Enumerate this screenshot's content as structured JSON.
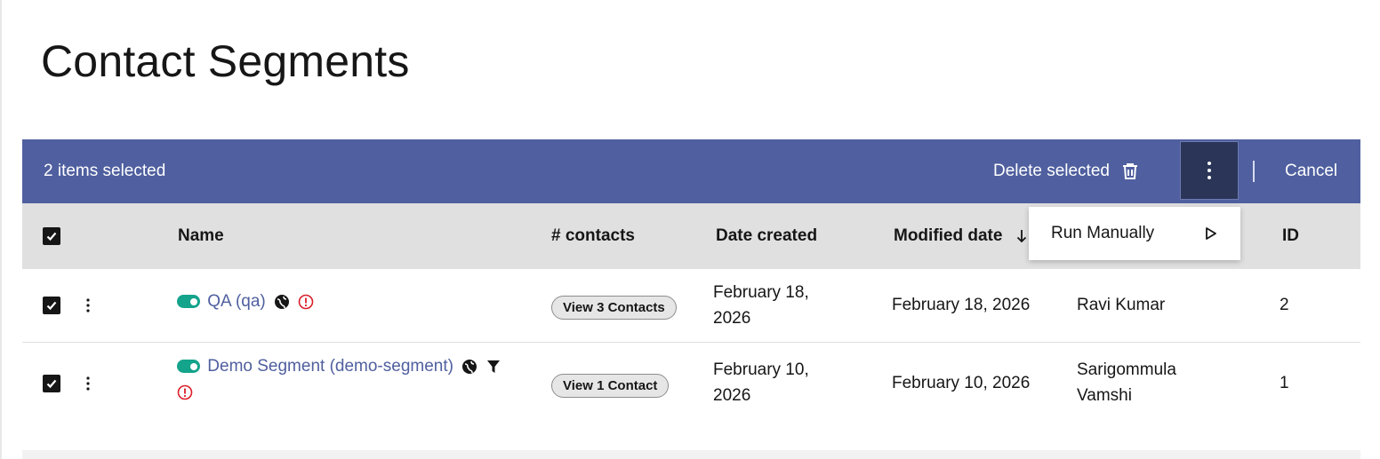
{
  "page": {
    "title": "Contact Segments"
  },
  "bulk_bar": {
    "selected_text": "2 items selected",
    "delete_label": "Delete selected",
    "cancel_label": "Cancel"
  },
  "menu": {
    "run_manually": "Run Manually"
  },
  "table": {
    "columns": {
      "name": "Name",
      "contacts": "# contacts",
      "date_created": "Date created",
      "modified_date": "Modified date",
      "id": "ID"
    },
    "rows": [
      {
        "name": "QA (qa)",
        "contacts_button": "View 3 Contacts",
        "date_created_line1": "February 18,",
        "date_created_line2": "2026",
        "modified_date": "February 18, 2026",
        "created_by_line1": "Ravi Kumar",
        "created_by_line2": "",
        "id": "2",
        "icons": [
          "toggle-on-icon",
          "globe-icon",
          "warning-icon"
        ]
      },
      {
        "name": "Demo Segment (demo-segment)",
        "contacts_button": "View 1 Contact",
        "date_created_line1": "February 10,",
        "date_created_line2": "2026",
        "modified_date": "February 10, 2026",
        "created_by_line1": "Sarigommula",
        "created_by_line2": "Vamshi",
        "id": "1",
        "icons": [
          "toggle-on-icon",
          "globe-icon",
          "filter-icon",
          "warning-icon"
        ]
      }
    ]
  },
  "colors": {
    "bulk_bar": "#4f5f9f",
    "kebab_active": "#2b3558",
    "header_bg": "#e0e0e0",
    "link": "#4f5f9f",
    "toggle_on": "#14a38b",
    "warning": "#da1e28"
  }
}
